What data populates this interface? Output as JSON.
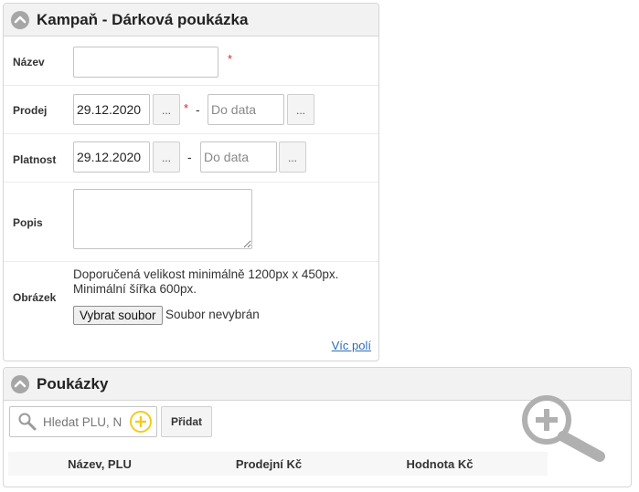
{
  "campaign": {
    "title": "Kampaň - Dárková poukázka",
    "name": {
      "label": "Název",
      "value": "",
      "required_mark": "*"
    },
    "sale": {
      "label": "Prodej",
      "from_value": "29.12.2020",
      "required_mark": "*",
      "separator": "-",
      "to_placeholder": "Do data",
      "picker_label": "..."
    },
    "validity": {
      "label": "Platnost",
      "from_value": "29.12.2020",
      "separator": "-",
      "to_placeholder": "Do data",
      "picker_label": "..."
    },
    "description": {
      "label": "Popis",
      "value": ""
    },
    "image": {
      "label": "Obrázek",
      "hint_line1": "Doporučená velikost minimálně 1200px x 450px.",
      "hint_line2": "Minimální šířka 600px.",
      "choose_button": "Vybrat soubor",
      "no_file": "Soubor nevybrán"
    },
    "more_fields": "Víc polí"
  },
  "vouchers": {
    "title": "Poukázky",
    "search_placeholder": "Hledat PLU, N",
    "add_button": "Přidat",
    "columns": [
      "Název, PLU",
      "Prodejní Kč",
      "Hodnota Kč"
    ]
  },
  "colors": {
    "required": "#d9262d",
    "link": "#2a6db5",
    "add_icon": "#f2cc1d",
    "collapse_icon": "#a6a6a6",
    "zoom_watermark": "#b0b0b0"
  },
  "icons": [
    "chevron-up-icon",
    "search-icon",
    "plus-circle-icon",
    "zoom-in-icon"
  ]
}
